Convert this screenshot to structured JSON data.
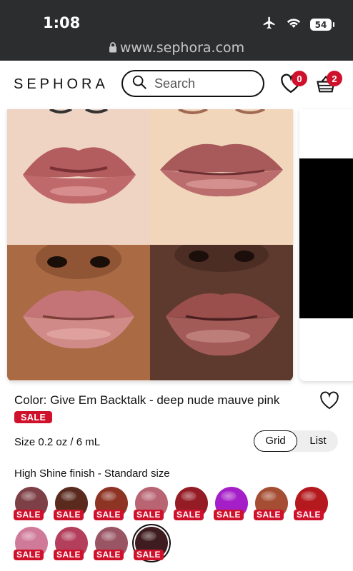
{
  "status_bar": {
    "time": "1:08",
    "battery": "54",
    "url": "www.sephora.com"
  },
  "header": {
    "logo": "SEPHORA",
    "search_placeholder": "Search",
    "loves_count": "0",
    "basket_count": "2"
  },
  "product": {
    "color_label": "Color: Give Em Backtalk - deep nude mauve pink",
    "sale_label": "SALE",
    "size_label": "Size 0.2 oz / 6 mL",
    "view_toggle": {
      "grid": "Grid",
      "list": "List",
      "selected": "Grid"
    },
    "finish_label": "High Shine finish - Standard size"
  },
  "swatches": [
    {
      "color": "#7d4046",
      "sale": "SALE"
    },
    {
      "color": "#5a2a1f",
      "sale": "SALE"
    },
    {
      "color": "#8e3424",
      "sale": "SALE"
    },
    {
      "color": "#b86472",
      "sale": "SALE"
    },
    {
      "color": "#941c24",
      "sale": "SALE"
    },
    {
      "color": "#a51fc8",
      "sale": "SALE"
    },
    {
      "color": "#a54e33",
      "sale": "SALE"
    },
    {
      "color": "#b3191d",
      "sale": "SALE"
    },
    {
      "color": "#cf7a98",
      "sale": "SALE"
    },
    {
      "color": "#b33f5c",
      "sale": "SALE"
    },
    {
      "color": "#9a5565",
      "sale": "SALE"
    },
    {
      "color": "#3e1c1f",
      "sale": "SALE",
      "selected": true
    }
  ],
  "colors": {
    "brand_red": "#cf112c",
    "status_bar": "#2b2d2f"
  }
}
